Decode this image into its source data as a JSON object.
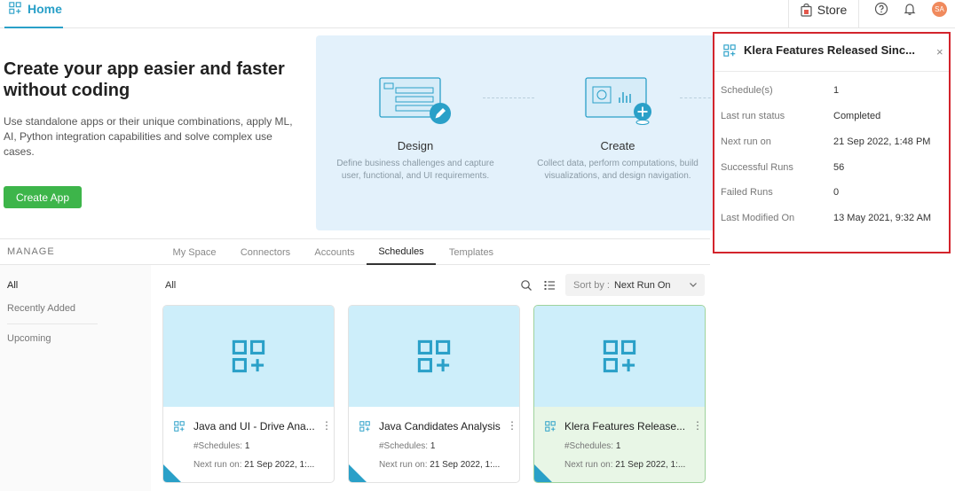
{
  "topbar": {
    "home_label": "Home",
    "store_label": "Store",
    "avatar_initials": "SA"
  },
  "hero": {
    "title": "Create your app easier and faster without coding",
    "description": "Use standalone apps or their unique combinations, apply ML, AI, Python integration capabilities and solve complex use cases.",
    "create_button": "Create App",
    "steps": [
      {
        "title": "Design",
        "desc": "Define business challenges and capture user, functional, and UI requirements."
      },
      {
        "title": "Create",
        "desc": "Collect data, perform computations, build visualizations, and design navigation."
      }
    ]
  },
  "manage": {
    "label": "MANAGE",
    "tabs": [
      "My Space",
      "Connectors",
      "Accounts",
      "Schedules",
      "Templates"
    ],
    "active_tab": "Schedules"
  },
  "nav": {
    "items": [
      "All",
      "Recently Added",
      "Upcoming"
    ]
  },
  "list": {
    "filter_label": "All",
    "sort_key": "Sort by :",
    "sort_value": "Next Run On"
  },
  "cards": [
    {
      "title": "Java and UI - Drive Ana...",
      "schedules_key": "#Schedules:",
      "schedules_val": "1",
      "next_key": "Next run on:",
      "next_val": "21 Sep 2022, 1:..."
    },
    {
      "title": "Java Candidates Analysis",
      "schedules_key": "#Schedules:",
      "schedules_val": "1",
      "next_key": "Next run on:",
      "next_val": "21 Sep 2022, 1:..."
    },
    {
      "title": "Klera Features Release...",
      "schedules_key": "#Schedules:",
      "schedules_val": "1",
      "next_key": "Next run on:",
      "next_val": "21 Sep 2022, 1:..."
    }
  ],
  "detail": {
    "title": "Klera Features Released Sinc...",
    "rows": [
      {
        "key": "Schedule(s)",
        "value": "1"
      },
      {
        "key": "Last run status",
        "value": "Completed"
      },
      {
        "key": "Next run on",
        "value": "21 Sep 2022, 1:48 PM"
      },
      {
        "key": "Successful Runs",
        "value": "56"
      },
      {
        "key": "Failed Runs",
        "value": "0"
      },
      {
        "key": "Last Modified On",
        "value": "13 May 2021, 9:32 AM"
      }
    ]
  },
  "colors": {
    "accent": "#2aa0c8",
    "create_button": "#3db54a",
    "highlight_border": "#d3242c",
    "card_top": "#cdeefa",
    "selected_card": "#e8f6e6"
  }
}
